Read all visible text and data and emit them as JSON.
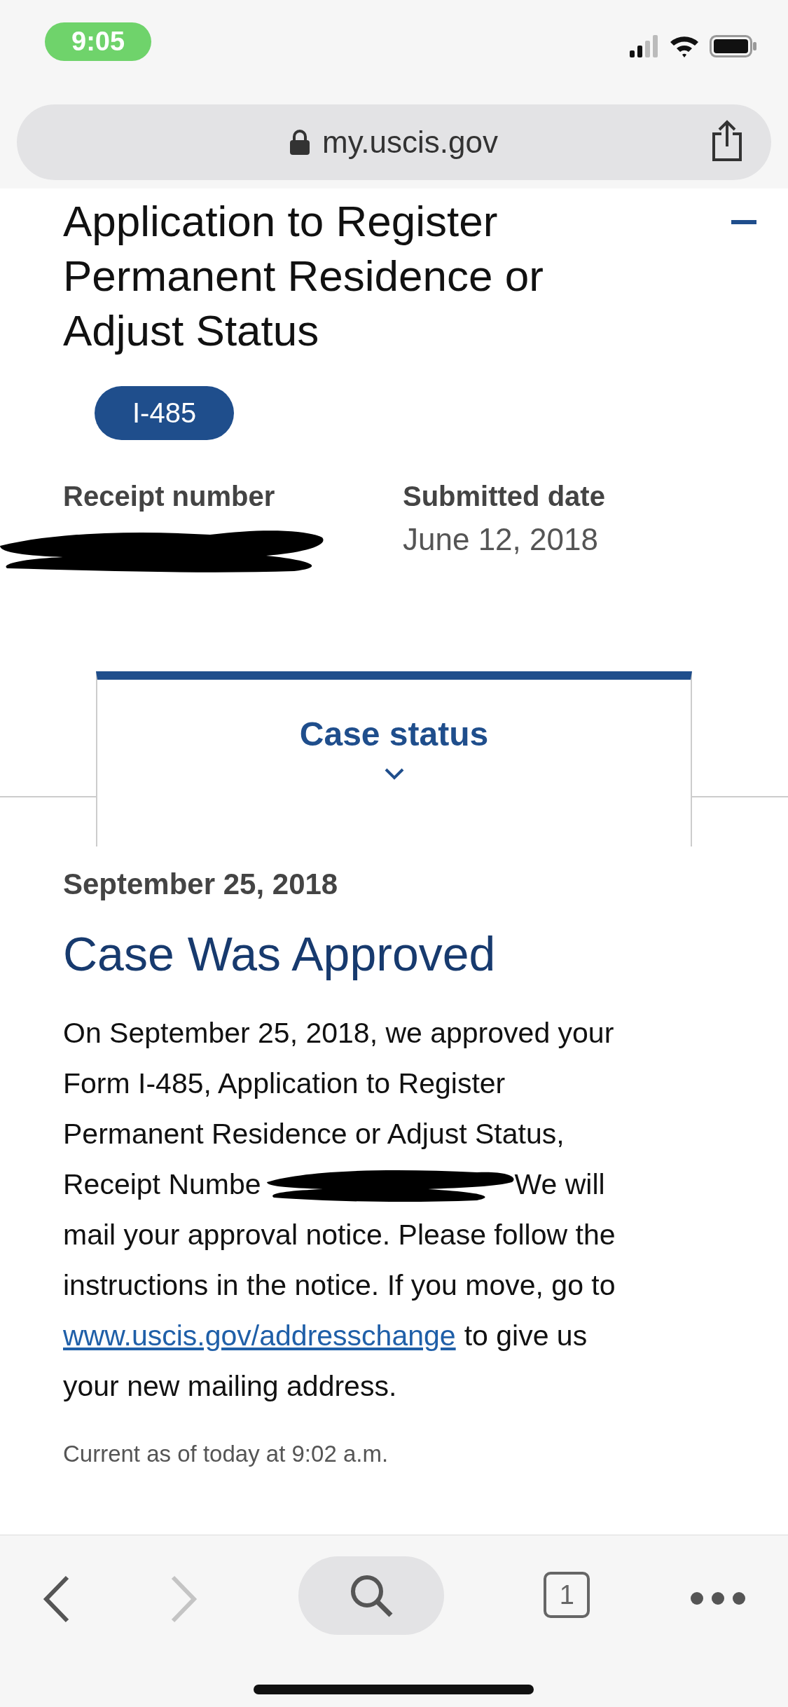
{
  "status_bar": {
    "time": "9:05"
  },
  "browser": {
    "url": "my.uscis.gov"
  },
  "case": {
    "title": "Application to Register Permanent Residence or Adjust Status",
    "expanded": true,
    "form_badge": "I-485",
    "receipt_label": "Receipt number",
    "submitted_label": "Submitted date",
    "submitted_value": "June 12, 2018"
  },
  "tabs": [
    {
      "label": "Case status",
      "selected": true
    }
  ],
  "status": {
    "date": "September 25, 2018",
    "heading": "Case Was Approved",
    "message_lines": [
      {
        "kind": "text",
        "text": "On September 25, 2018, we approved your"
      },
      {
        "kind": "text",
        "text": "Form I-485, Application to Register"
      },
      {
        "kind": "text",
        "text": "Permanent Residence or Adjust Status,"
      },
      {
        "kind": "redacted",
        "before": "Receipt Numbe",
        "after": "We will"
      },
      {
        "kind": "text",
        "text": "mail your approval notice. Please follow the"
      },
      {
        "kind": "text",
        "text": "instructions in the notice. If you move, go to"
      },
      {
        "kind": "link",
        "link": "www.uscis.gov/addresschange",
        "after": "to give us"
      },
      {
        "kind": "text",
        "text": "your new mailing address."
      }
    ],
    "updated": "Current as of today at 9:02 a.m."
  },
  "toolbar": {
    "tab_count": "1",
    "forward_disabled": true
  }
}
